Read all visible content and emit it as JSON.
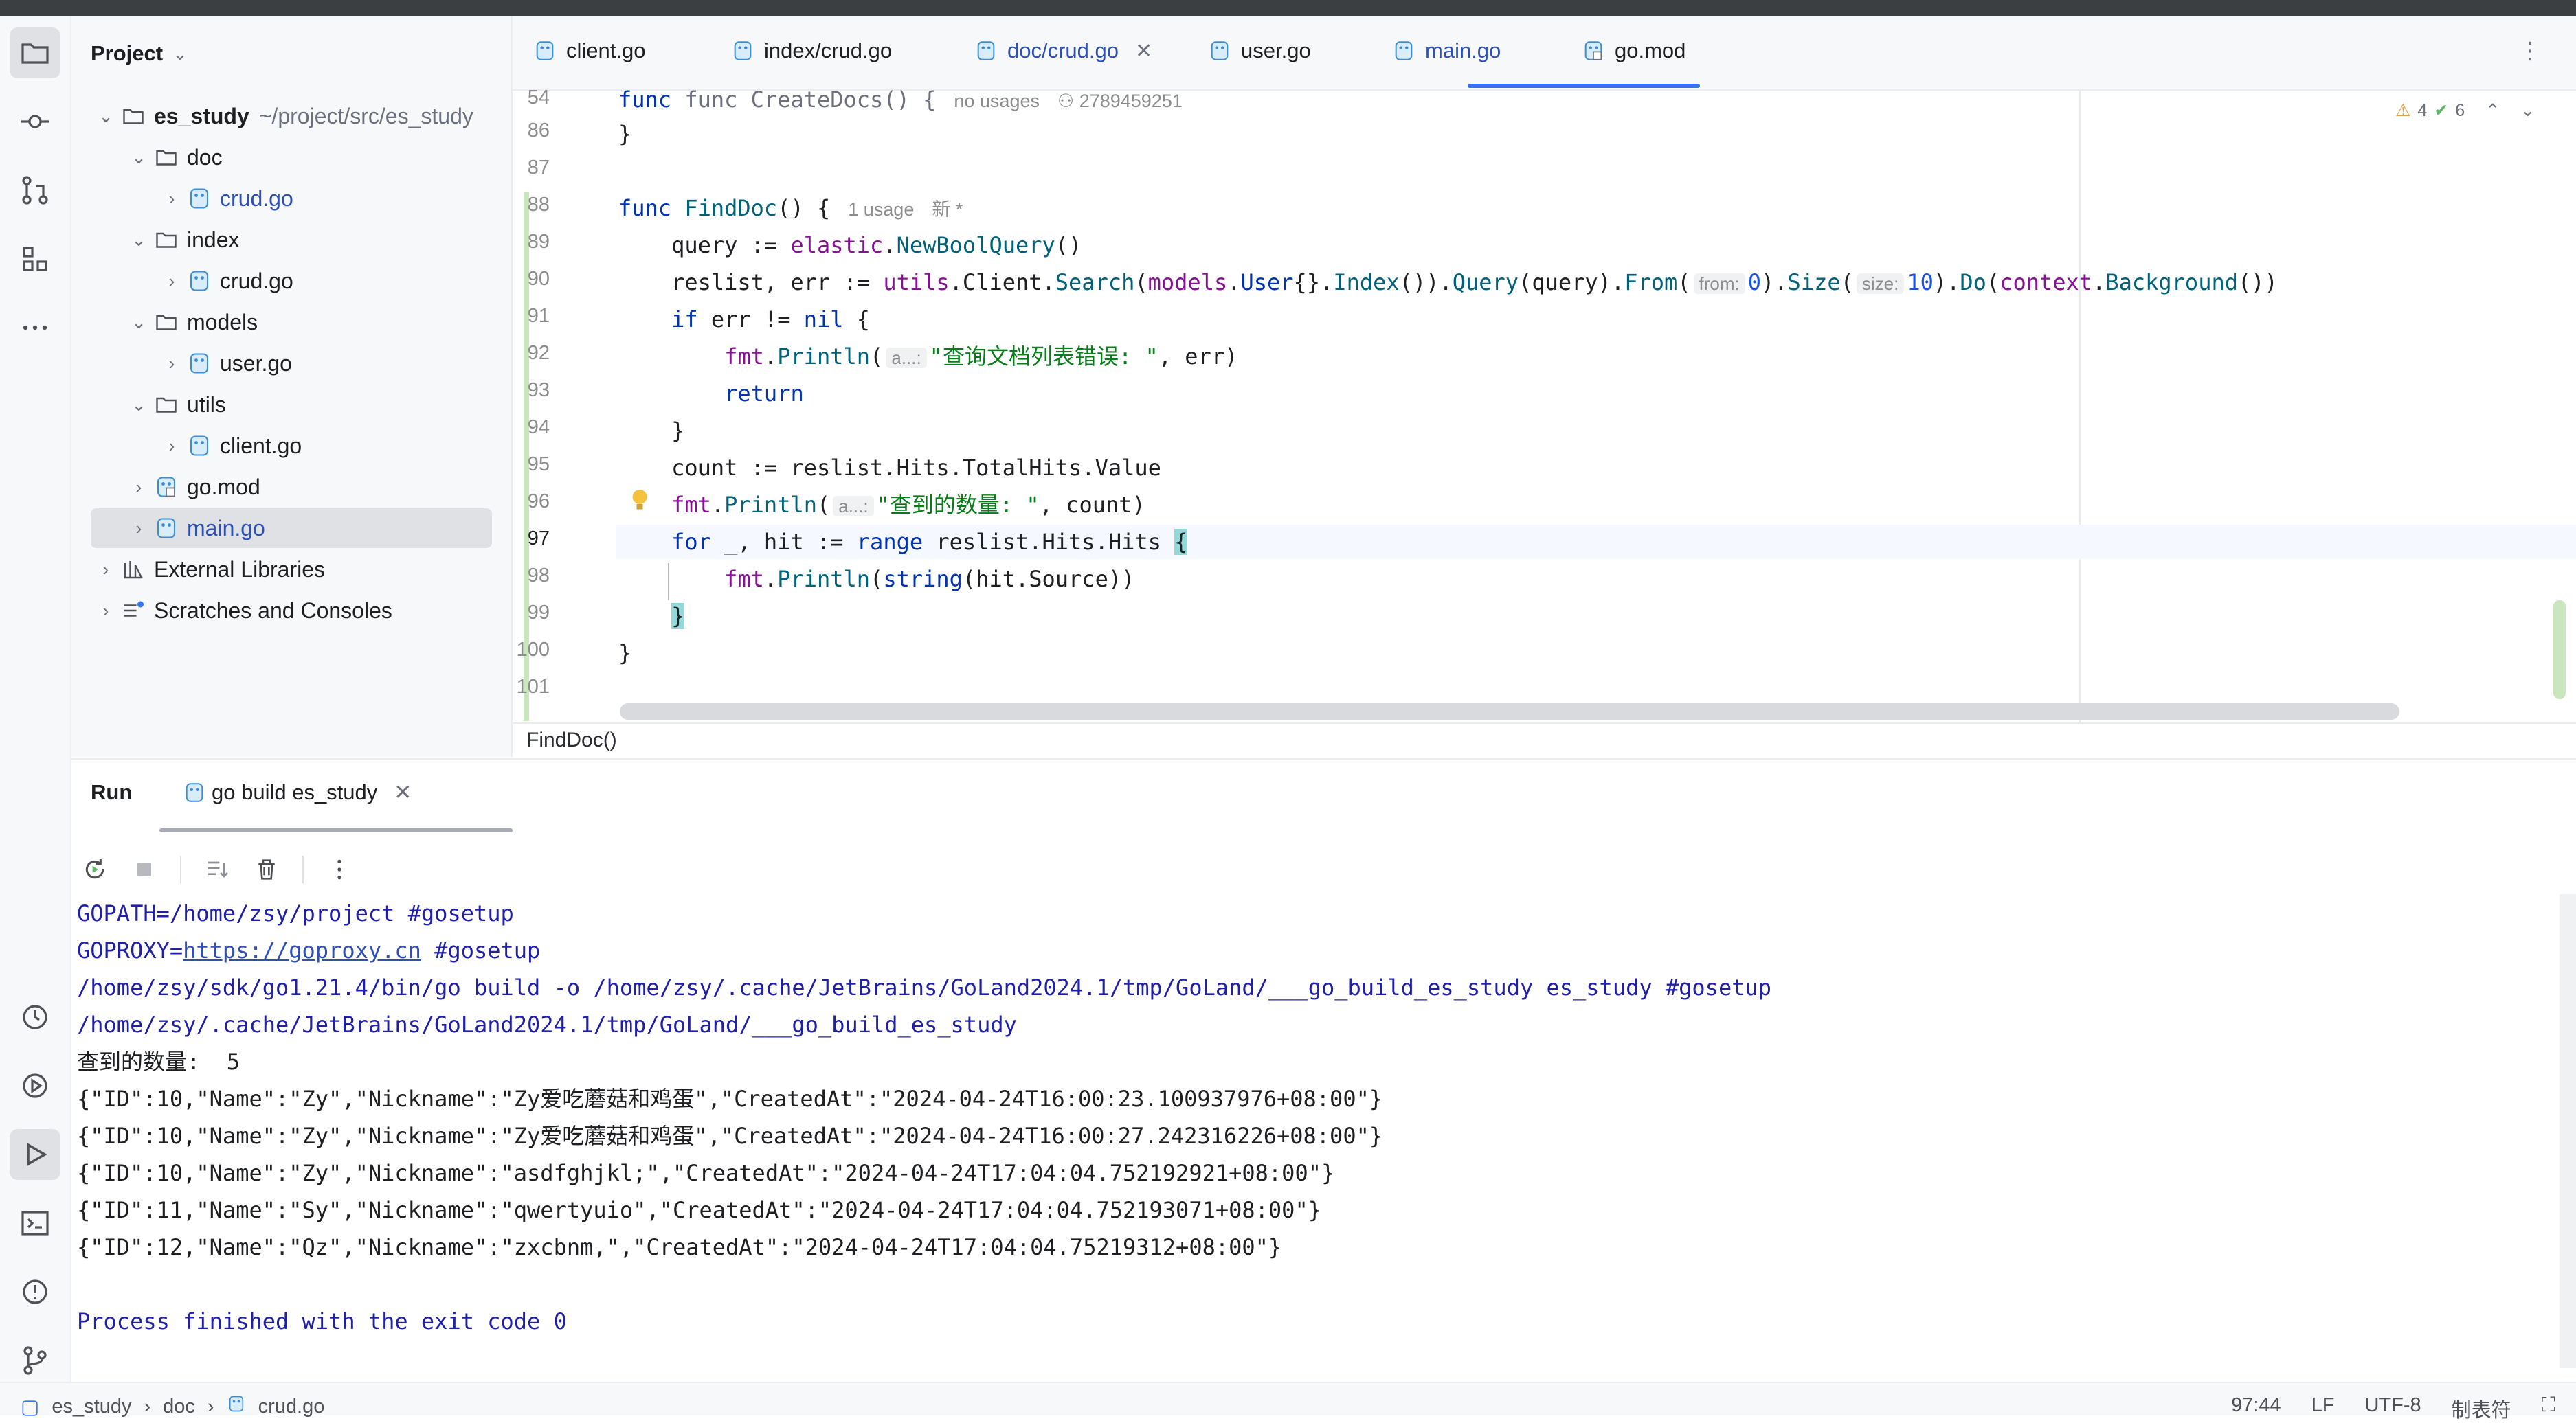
{
  "project_panel": {
    "title": "Project",
    "tree": [
      {
        "label": "es_study",
        "path": "~/project/src/es_study",
        "kind": "root-folder"
      },
      {
        "label": "doc",
        "kind": "folder"
      },
      {
        "label": "crud.go",
        "kind": "go-file"
      },
      {
        "label": "index",
        "kind": "folder"
      },
      {
        "label": "crud.go",
        "kind": "go-file"
      },
      {
        "label": "models",
        "kind": "folder"
      },
      {
        "label": "user.go",
        "kind": "go-file"
      },
      {
        "label": "utils",
        "kind": "folder"
      },
      {
        "label": "client.go",
        "kind": "go-file"
      },
      {
        "label": "go.mod",
        "kind": "mod-file"
      },
      {
        "label": "main.go",
        "kind": "go-file",
        "selected": true
      },
      {
        "label": "External Libraries",
        "kind": "library"
      },
      {
        "label": "Scratches and Consoles",
        "kind": "scratches"
      }
    ]
  },
  "tabs": [
    {
      "label": "client.go"
    },
    {
      "label": "index/crud.go"
    },
    {
      "label": "doc/crud.go",
      "active": true
    },
    {
      "label": "user.go"
    },
    {
      "label": "main.go"
    },
    {
      "label": "go.mod"
    }
  ],
  "editor": {
    "inspections": {
      "warnings": "4",
      "checks": "6"
    },
    "sticky_line": {
      "number": "54",
      "code": "func CreateDocs() {",
      "usages": "no usages",
      "author": "2789459251"
    },
    "line_numbers": [
      "86",
      "87",
      "88",
      "89",
      "90",
      "91",
      "92",
      "93",
      "94",
      "95",
      "96",
      "97",
      "98",
      "99",
      "100",
      "101"
    ],
    "func_hint": {
      "usages": "1 usage",
      "new": "新 *"
    },
    "hints": {
      "from": "from:",
      "size": "size:",
      "a1": "a...:",
      "a2": "a...:"
    },
    "strings": {
      "err_msg": "\"查询文档列表错误: \"",
      "count_msg": "\"查到的数量: \""
    },
    "numbers": {
      "from": "0",
      "size": "10"
    },
    "current_line": "97",
    "breadcrumb": "FindDoc()"
  },
  "run_panel": {
    "title": "Run",
    "tab_label": "go build es_study",
    "console": {
      "gopath": "GOPATH=/home/zsy/project #gosetup",
      "goproxy_prefix": "GOPROXY=",
      "goproxy_link": "https://goproxy.cn",
      "goproxy_suffix": " #gosetup",
      "build_cmd": "/home/zsy/sdk/go1.21.4/bin/go build -o /home/zsy/.cache/JetBrains/GoLand2024.1/tmp/GoLand/___go_build_es_study es_study #gosetup",
      "run_cmd": "/home/zsy/.cache/JetBrains/GoLand2024.1/tmp/GoLand/___go_build_es_study",
      "count_line": "查到的数量:  5",
      "results": [
        "{\"ID\":10,\"Name\":\"Zy\",\"Nickname\":\"Zy爱吃蘑菇和鸡蛋\",\"CreatedAt\":\"2024-04-24T16:00:23.100937976+08:00\"}",
        "{\"ID\":10,\"Name\":\"Zy\",\"Nickname\":\"Zy爱吃蘑菇和鸡蛋\",\"CreatedAt\":\"2024-04-24T16:00:27.242316226+08:00\"}",
        "{\"ID\":10,\"Name\":\"Zy\",\"Nickname\":\"asdfghjkl;\",\"CreatedAt\":\"2024-04-24T17:04:04.752192921+08:00\"}",
        "{\"ID\":11,\"Name\":\"Sy\",\"Nickname\":\"qwertyuio\",\"CreatedAt\":\"2024-04-24T17:04:04.752193071+08:00\"}",
        "{\"ID\":12,\"Name\":\"Qz\",\"Nickname\":\"zxcbnm,\",\"CreatedAt\":\"2024-04-24T17:04:04.75219312+08:00\"}"
      ],
      "exit_line": "Process finished with the exit code 0"
    }
  },
  "statusbar": {
    "crumbs": [
      "es_study",
      "doc",
      "crud.go"
    ],
    "position": "97:44",
    "line_ending": "LF",
    "encoding": "UTF-8",
    "indent": "制表符"
  },
  "colors": {
    "accent": "#3574f0",
    "keyword": "#0033b3",
    "string": "#067d17",
    "function": "#00627a",
    "package": "#871094",
    "console_system": "#1f1fa8"
  }
}
